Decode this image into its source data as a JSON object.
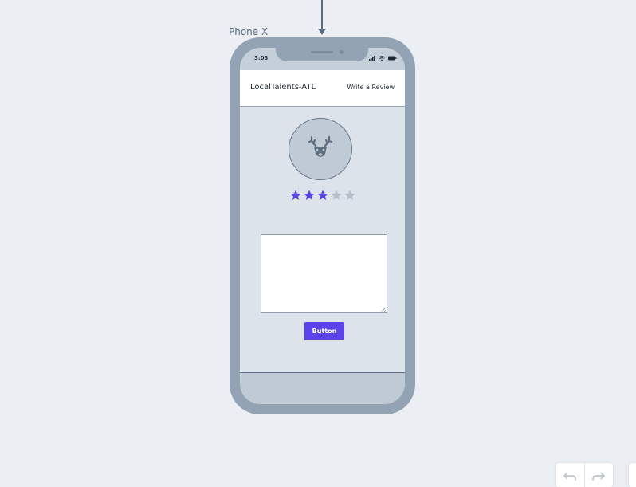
{
  "canvas": {
    "frame_label": "Phone X",
    "background_color": "#ebeff4"
  },
  "phone": {
    "status_bar": {
      "time": "3:03",
      "icons": [
        "signal-icon",
        "wifi-icon",
        "battery-icon"
      ]
    },
    "header": {
      "title": "LocalTalents-ATL",
      "action_label": "Write a Review"
    },
    "profile": {
      "avatar_icon": "deer-icon"
    },
    "rating": {
      "value": 3,
      "max": 5,
      "filled_color": "#5a43e8",
      "empty_color": "#b4bfcc"
    },
    "review": {
      "value": "",
      "placeholder": ""
    },
    "submit_button": {
      "label": "Button",
      "color": "#5a43e8"
    }
  },
  "toolbar": {
    "undo_icon": "undo-icon",
    "redo_icon": "redo-icon"
  }
}
